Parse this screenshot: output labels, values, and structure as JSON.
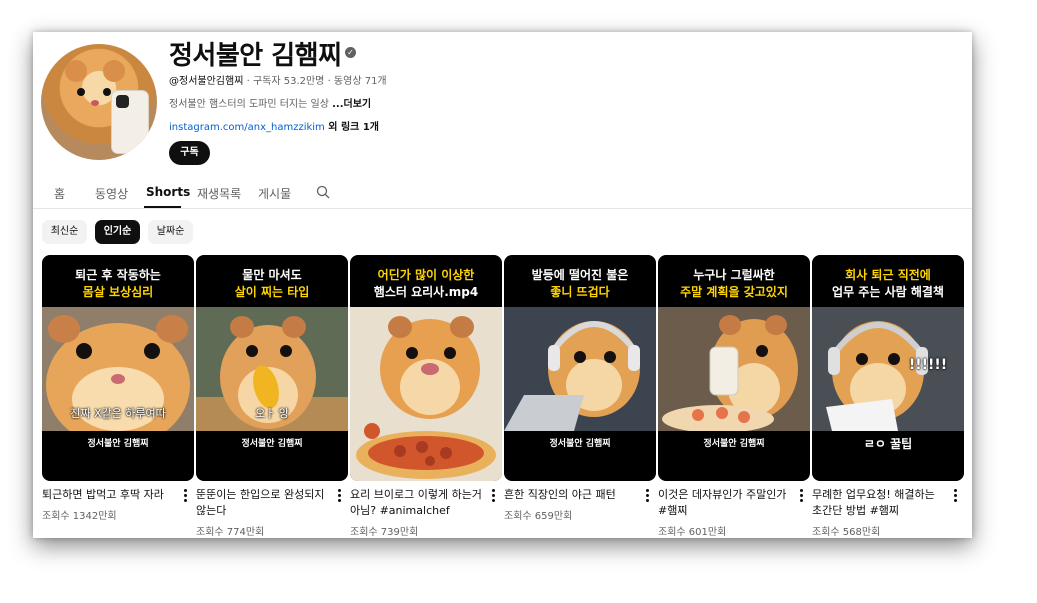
{
  "channel": {
    "name": "정서불안 김햄찌",
    "handle": "@정서불안김햄찌",
    "stats": " · 구독자 53.2만명 · 동영상 71개",
    "description": "정서불안 햄스터의 도파민 터지는 일상 ",
    "more": "...더보기",
    "link_url": "instagram.com/anx_hamzzikim",
    "link_extra": " 외 링크 1개",
    "subscribe": "구독",
    "verified_icon": "verified-check-icon"
  },
  "tabs": [
    "홈",
    "동영상",
    "Shorts",
    "재생목록",
    "게시물"
  ],
  "active_tab": "Shorts",
  "sort_chips": [
    "최신순",
    "인기순",
    "날짜순"
  ],
  "active_chip": "인기순",
  "colors": {
    "accent_yellow": "#ffd400",
    "link_blue": "#065fd4",
    "text_dark": "#0f0f0f",
    "text_gray": "#606060"
  },
  "shorts": [
    {
      "cap1": "퇴근 후 작동하는",
      "cap2": "몸살 보상심리",
      "overlay": "진짜 X같은 하루여따",
      "footer": "정서불안 김햄찌",
      "title": "퇴근하면 밥먹고 후딱 자라",
      "views": "조회수 1342만회"
    },
    {
      "cap1": "물만 마셔도",
      "cap2": "살이 찌는 타입",
      "overlay": "오ㅏ 앙",
      "footer": "정서불안 김햄찌",
      "title": "뚠뚠이는 한입으로 완성되지 않는다",
      "views": "조회수 774만회"
    },
    {
      "cap1": "어딘가 많이 이상한",
      "cap2": "햄스터 요리사.mp4",
      "overlay": "",
      "footer": "",
      "title": "요리 브이로그 이렇게 하는거 아님? #animalchef",
      "views": "조회수 739만회"
    },
    {
      "cap1": "발등에 떨어진 불은",
      "cap2": "좋니 뜨겁다",
      "overlay": "",
      "footer": "정서불안 김햄찌",
      "title": "흔한 직장인의 야근 패턴",
      "views": "조회수 659만회"
    },
    {
      "cap1": "누구나 그럴싸한",
      "cap2": "주말 계획을 갖고있지",
      "overlay": "",
      "footer": "정서불안 김햄찌",
      "title": "이것은 데자뷰인가 주말인가 #햄찌",
      "views": "조회수 601만회"
    },
    {
      "cap1": "회사 퇴근 직전에",
      "cap2": "업무 주는 사람 해결책",
      "overlay": "!!!!!!",
      "footer": "ㄹㅇ 꿀팁",
      "title": "무례한 업무요청! 해결하는 초간단 방법 #햄찌",
      "views": "조회수 568만회"
    }
  ]
}
